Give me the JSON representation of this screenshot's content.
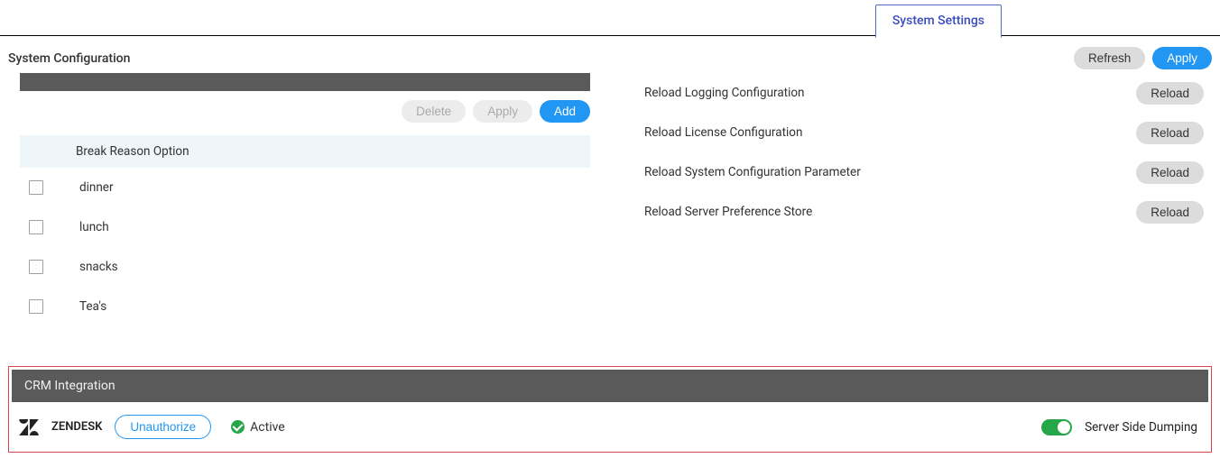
{
  "topTab": {
    "label": "System Settings"
  },
  "header": {
    "title": "System Configuration",
    "refresh": "Refresh",
    "apply": "Apply"
  },
  "breakReason": {
    "actions": {
      "delete": "Delete",
      "apply": "Apply",
      "add": "Add"
    },
    "headerLabel": "Break Reason Option",
    "options": [
      {
        "label": "dinner"
      },
      {
        "label": "lunch"
      },
      {
        "label": "snacks"
      },
      {
        "label": "Tea's"
      }
    ]
  },
  "reloadItems": [
    {
      "label": "Reload Logging Configuration",
      "button": "Reload"
    },
    {
      "label": "Reload License Configuration",
      "button": "Reload"
    },
    {
      "label": "Reload System Configuration Parameter",
      "button": "Reload"
    },
    {
      "label": "Reload Server Preference Store",
      "button": "Reload"
    }
  ],
  "crm": {
    "sectionTitle": "CRM Integration",
    "provider": "ZENDESK",
    "unauthorize": "Unauthorize",
    "status": "Active",
    "dumpingLabel": "Server Side Dumping"
  }
}
